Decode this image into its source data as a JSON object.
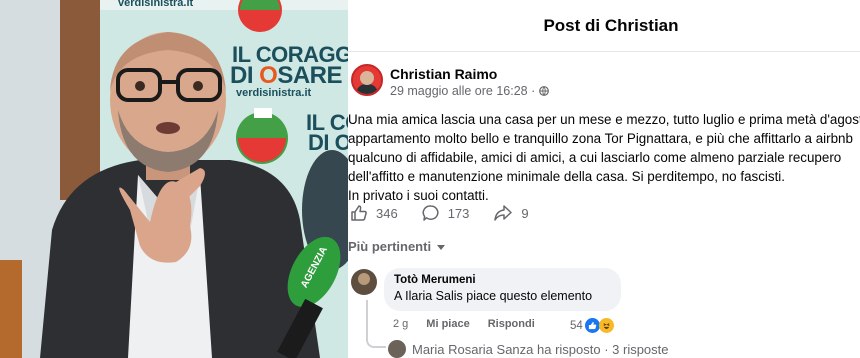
{
  "banner": {
    "url": "verdisinistra.it",
    "line1": "IL CORAGGIO",
    "line2_pre": "DI ",
    "line2_o": "O",
    "line2_post": "SARE",
    "il_co": "IL CO",
    "di_o": "DI O",
    "mic_text": "AGENZIA"
  },
  "post": {
    "header_title": "Post di Christian",
    "author": "Christian Raimo",
    "timestamp": "29 maggio alle ore 16:28 ·",
    "body_lines": [
      "Una mia amica lascia una casa per un mese e mezzo, tutto luglio e prima metà d'agosto",
      "appartamento molto bello e tranquillo zona Tor Pignattara, e più che affittarlo a airbnb",
      "qualcuno di affidabile, amici di amici, a cui lasciarlo come almeno parziale recupero",
      "dell'affitto e manutenzione minimale della casa. Si perditempo, no fascisti.",
      "In privato i suoi contatti."
    ],
    "likes": "346",
    "comments": "173",
    "shares": "9",
    "sort_label": "Più pertinenti"
  },
  "comment": {
    "author": "Totò Merumeni",
    "text": "A Ilaria Salis piace questo elemento",
    "time": "2 g",
    "like_label": "Mi piace",
    "reply_label": "Rispondi",
    "reaction_count": "54",
    "replies": "Maria Rosaria Sanza ha risposto · 3 risposte"
  },
  "colors": {
    "accent_blue": "#1877f2",
    "text_secondary": "#65676b",
    "bubble_bg": "#f0f2f5"
  },
  "icons": [
    "globe-icon",
    "like-icon",
    "comment-icon",
    "share-icon",
    "chevron-down-icon",
    "like-reaction-icon",
    "haha-reaction-icon"
  ]
}
